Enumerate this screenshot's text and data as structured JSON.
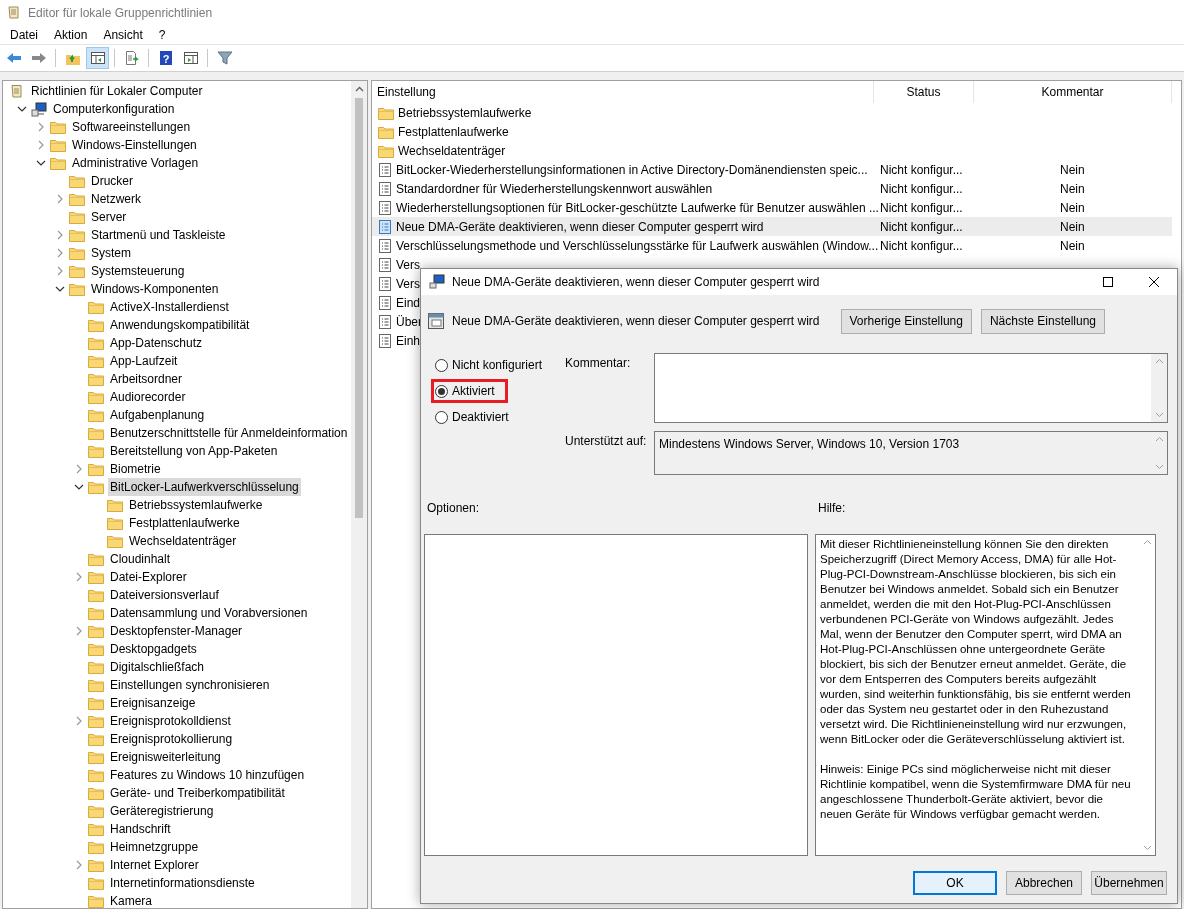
{
  "window": {
    "title": "Editor für lokale Gruppenrichtlinien"
  },
  "menu": [
    "Datei",
    "Aktion",
    "Ansicht",
    "?"
  ],
  "toolbar": [
    {
      "kind": "back",
      "pressed": false
    },
    {
      "kind": "forward",
      "pressed": false
    },
    {
      "kind": "sep"
    },
    {
      "kind": "up",
      "pressed": false
    },
    {
      "kind": "tree",
      "pressed": true
    },
    {
      "kind": "sep"
    },
    {
      "kind": "export",
      "pressed": false
    },
    {
      "kind": "sep"
    },
    {
      "kind": "help",
      "glyph": "?",
      "pressed": false
    },
    {
      "kind": "pane",
      "pressed": false
    },
    {
      "kind": "sep"
    },
    {
      "kind": "filter",
      "pressed": false
    }
  ],
  "tree": [
    {
      "label": "Richtlinien für Lokaler Computer",
      "kind": "policy",
      "selected": false,
      "children": [
        {
          "label": "Computerkonfiguration",
          "kind": "computer",
          "expanded": true,
          "selected": false,
          "children": [
            {
              "label": "Softwareeinstellungen",
              "kind": "folder",
              "expanded": false,
              "selected": false
            },
            {
              "label": "Windows-Einstellungen",
              "kind": "folder",
              "expanded": false,
              "selected": false
            },
            {
              "label": "Administrative Vorlagen",
              "kind": "folder",
              "expanded": true,
              "selected": false,
              "children": [
                {
                  "label": "Drucker",
                  "kind": "folder",
                  "selected": false
                },
                {
                  "label": "Netzwerk",
                  "kind": "folder",
                  "expanded": false,
                  "selected": false
                },
                {
                  "label": "Server",
                  "kind": "folder",
                  "selected": false
                },
                {
                  "label": "Startmenü und Taskleiste",
                  "kind": "folder",
                  "expanded": false,
                  "selected": false
                },
                {
                  "label": "System",
                  "kind": "folder",
                  "expanded": false,
                  "selected": false
                },
                {
                  "label": "Systemsteuerung",
                  "kind": "folder",
                  "expanded": false,
                  "selected": false
                },
                {
                  "label": "Windows-Komponenten",
                  "kind": "folder",
                  "expanded": true,
                  "selected": false,
                  "children": [
                    {
                      "label": "ActiveX-Installerdienst",
                      "kind": "folder",
                      "selected": false
                    },
                    {
                      "label": "Anwendungskompatibilität",
                      "kind": "folder",
                      "selected": false
                    },
                    {
                      "label": "App-Datenschutz",
                      "kind": "folder",
                      "selected": false
                    },
                    {
                      "label": "App-Laufzeit",
                      "kind": "folder",
                      "selected": false
                    },
                    {
                      "label": "Arbeitsordner",
                      "kind": "folder",
                      "selected": false
                    },
                    {
                      "label": "Audiorecorder",
                      "kind": "folder",
                      "selected": false
                    },
                    {
                      "label": "Aufgabenplanung",
                      "kind": "folder",
                      "selected": false
                    },
                    {
                      "label": "Benutzerschnittstelle für Anmeldeinformation",
                      "kind": "folder",
                      "selected": false
                    },
                    {
                      "label": "Bereitstellung von App-Paketen",
                      "kind": "folder",
                      "selected": false
                    },
                    {
                      "label": "Biometrie",
                      "kind": "folder",
                      "expanded": false,
                      "selected": false
                    },
                    {
                      "label": "BitLocker-Laufwerkverschlüsselung",
                      "kind": "folder",
                      "expanded": true,
                      "selected": true,
                      "children": [
                        {
                          "label": "Betriebssystemlaufwerke",
                          "kind": "folder",
                          "selected": false
                        },
                        {
                          "label": "Festplattenlaufwerke",
                          "kind": "folder",
                          "selected": false
                        },
                        {
                          "label": "Wechseldatenträger",
                          "kind": "folder",
                          "selected": false
                        }
                      ]
                    },
                    {
                      "label": "Cloudinhalt",
                      "kind": "folder",
                      "selected": false
                    },
                    {
                      "label": "Datei-Explorer",
                      "kind": "folder",
                      "expanded": false,
                      "selected": false
                    },
                    {
                      "label": "Dateiversionsverlauf",
                      "kind": "folder",
                      "selected": false
                    },
                    {
                      "label": "Datensammlung und Vorabversionen",
                      "kind": "folder",
                      "selected": false
                    },
                    {
                      "label": "Desktopfenster-Manager",
                      "kind": "folder",
                      "expanded": false,
                      "selected": false
                    },
                    {
                      "label": "Desktopgadgets",
                      "kind": "folder",
                      "selected": false
                    },
                    {
                      "label": "Digitalschließfach",
                      "kind": "folder",
                      "selected": false
                    },
                    {
                      "label": "Einstellungen synchronisieren",
                      "kind": "folder",
                      "selected": false
                    },
                    {
                      "label": "Ereignisanzeige",
                      "kind": "folder",
                      "selected": false
                    },
                    {
                      "label": "Ereignisprotokolldienst",
                      "kind": "folder",
                      "expanded": false,
                      "selected": false
                    },
                    {
                      "label": "Ereignisprotokollierung",
                      "kind": "folder",
                      "selected": false
                    },
                    {
                      "label": "Ereignisweiterleitung",
                      "kind": "folder",
                      "selected": false
                    },
                    {
                      "label": "Features zu Windows 10 hinzufügen",
                      "kind": "folder",
                      "selected": false
                    },
                    {
                      "label": "Geräte- und Treiberkompatibilität",
                      "kind": "folder",
                      "selected": false
                    },
                    {
                      "label": "Geräteregistrierung",
                      "kind": "folder",
                      "selected": false
                    },
                    {
                      "label": "Handschrift",
                      "kind": "folder",
                      "selected": false
                    },
                    {
                      "label": "Heimnetzgruppe",
                      "kind": "folder",
                      "selected": false
                    },
                    {
                      "label": "Internet Explorer",
                      "kind": "folder",
                      "expanded": false,
                      "selected": false
                    },
                    {
                      "label": "Internetinformationsdienste",
                      "kind": "folder",
                      "selected": false
                    },
                    {
                      "label": "Kamera",
                      "kind": "folder",
                      "selected": false
                    }
                  ]
                }
              ]
            }
          ]
        }
      ]
    }
  ],
  "list": {
    "columns": [
      "Einstellung",
      "Status",
      "Kommentar"
    ],
    "rows": [
      {
        "kind": "folder",
        "name": "Betriebssystemlaufwerke",
        "selected": false
      },
      {
        "kind": "folder",
        "name": "Festplattenlaufwerke",
        "selected": false
      },
      {
        "kind": "folder",
        "name": "Wechseldatenträger",
        "selected": false
      },
      {
        "kind": "setting",
        "name": "BitLocker-Wiederherstellungsinformationen in Active Directory-Domänendiensten speic...",
        "status": "Nicht konfigur...",
        "comment": "Nein",
        "selected": false
      },
      {
        "kind": "setting",
        "name": "Standardordner für Wiederherstellungskennwort auswählen",
        "status": "Nicht konfigur...",
        "comment": "Nein",
        "selected": false
      },
      {
        "kind": "setting",
        "name": "Wiederherstellungsoptionen für BitLocker-geschützte Laufwerke für Benutzer auswählen ...",
        "status": "Nicht konfigur...",
        "comment": "Nein",
        "selected": false
      },
      {
        "kind": "setting",
        "name": "Neue DMA-Geräte deaktivieren, wenn dieser Computer gesperrt wird",
        "status": "Nicht konfigur...",
        "comment": "Nein",
        "selected": true
      },
      {
        "kind": "setting",
        "name": "Verschlüsselungsmethode und Verschlüsselungsstärke für Laufwerk auswählen (Window...",
        "status": "Nicht konfigur...",
        "comment": "Nein",
        "selected": false
      },
      {
        "kind": "setting",
        "name": "Vers",
        "selected": false
      },
      {
        "kind": "setting",
        "name": "Vers",
        "selected": false
      },
      {
        "kind": "setting",
        "name": "Eind",
        "selected": false
      },
      {
        "kind": "setting",
        "name": "Über",
        "selected": false
      },
      {
        "kind": "setting",
        "name": "Einh",
        "selected": false
      }
    ]
  },
  "dialog": {
    "title": "Neue DMA-Geräte deaktivieren, wenn dieser Computer gesperrt wird",
    "heading": "Neue DMA-Geräte deaktivieren, wenn dieser Computer gesperrt wird",
    "nav_buttons": [
      "Vorherige Einstellung",
      "Nächste Einstellung"
    ],
    "options": [
      {
        "label": "Nicht konfiguriert",
        "selected": false,
        "highlighted": false
      },
      {
        "label": "Aktiviert",
        "selected": true,
        "highlighted": true
      },
      {
        "label": "Deaktiviert",
        "selected": false,
        "highlighted": false
      }
    ],
    "comment_label": "Kommentar:",
    "supported_label": "Unterstützt auf:",
    "supported_value": "Mindestens Windows Server, Windows 10, Version 1703",
    "options_label": "Optionen:",
    "help_label": "Hilfe:",
    "help_text": [
      "Mit dieser Richtlinieneinstellung können Sie den direkten Speicherzugriff (Direct Memory Access, DMA) für alle Hot-Plug-PCI-Downstream-Anschlüsse blockieren, bis sich ein Benutzer bei Windows anmeldet. Sobald sich ein Benutzer anmeldet, werden die mit den Hot-Plug-PCI-Anschlüssen verbundenen PCI-Geräte von Windows aufgezählt. Jedes Mal, wenn der Benutzer den Computer sperrt, wird DMA an Hot-Plug-PCI-Anschlüssen ohne untergeordnete Geräte blockiert, bis sich der Benutzer erneut anmeldet. Geräte, die vor dem Entsperren des Computers bereits aufgezählt wurden, sind weiterhin funktionsfähig, bis sie entfernt werden oder das System neu gestartet oder in den Ruhezustand versetzt wird. Die Richtlinieneinstellung wird nur erzwungen, wenn BitLocker oder die Geräteverschlüsselung aktiviert ist.",
      "Hinweis: Einige PCs sind möglicherweise nicht mit dieser Richtlinie kompatibel, wenn die Systemfirmware DMA für neu angeschlossene Thunderbolt-Geräte aktiviert, bevor die neuen Geräte für Windows verfügbar gemacht werden."
    ],
    "buttons": [
      {
        "label": "OK",
        "default": true
      },
      {
        "label": "Abbrechen",
        "default": false
      },
      {
        "label": "Übernehmen",
        "default": false
      }
    ]
  }
}
